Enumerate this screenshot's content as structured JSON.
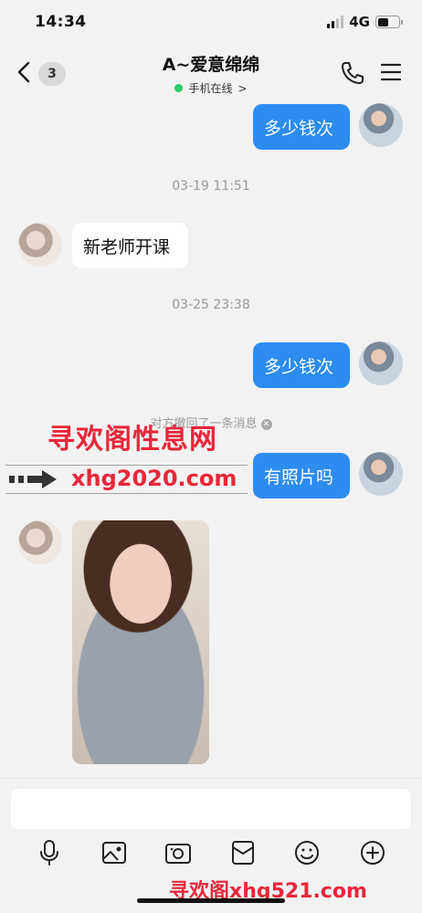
{
  "status_bar": {
    "time": "14:34",
    "network": "4G",
    "battery_level": 0.5
  },
  "header": {
    "unread_count": "3",
    "title": "A~爱意绵绵",
    "online_status": "手机在线",
    "online_chevron": ">",
    "online_color": "#2ccb6c"
  },
  "messages": {
    "msg1_out": "多少钱次",
    "time1": "03-19 11:51",
    "msg2_in": "新老师开课",
    "time2": "03-25 23:38",
    "msg3_out": "多少钱次",
    "recall_notice": "对方撤回了一条消息",
    "msg4_out": "有照片吗"
  },
  "watermarks": {
    "big": "寻欢阁性息网",
    "url": "xhg2020.com",
    "bottom": "寻欢阁xhg521.com"
  },
  "input": {
    "placeholder": ""
  },
  "colors": {
    "bubble_out": "#2d8cf0",
    "watermark": "#e8273a"
  },
  "icons": [
    "back-icon",
    "phone-icon",
    "menu-icon",
    "microphone-icon",
    "image-icon",
    "camera-icon",
    "red-packet-icon",
    "emoji-icon",
    "plus-icon"
  ]
}
